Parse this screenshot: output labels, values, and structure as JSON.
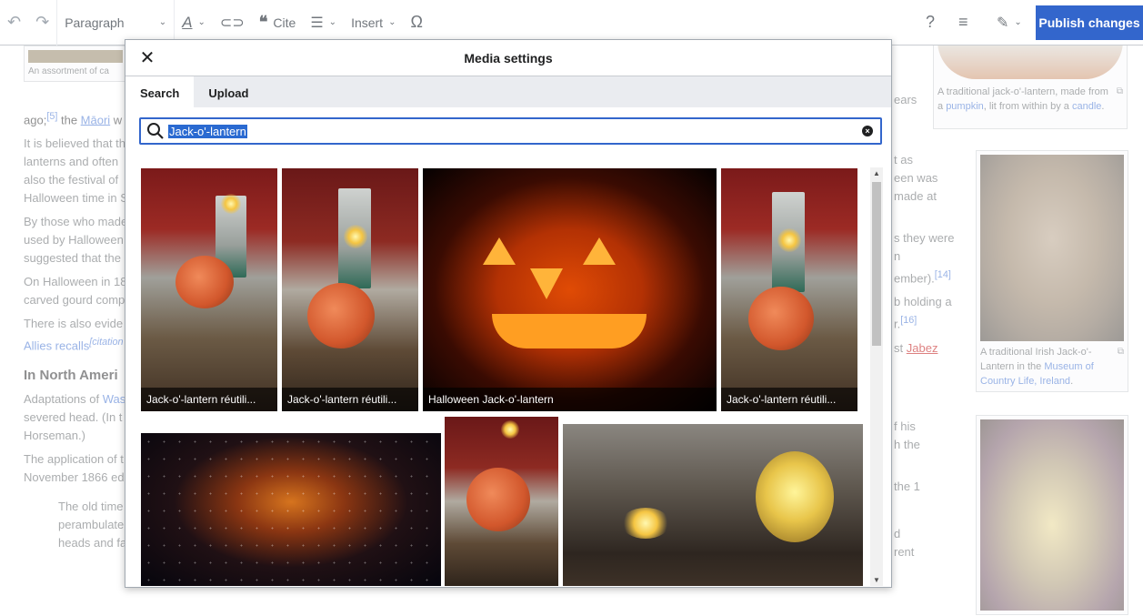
{
  "toolbar": {
    "format_label": "Paragraph",
    "cite_label": "Cite",
    "insert_label": "Insert",
    "help_glyph": "?",
    "publish_label": "Publish changes"
  },
  "article": {
    "top_thumb_caption": "An assortment of ca",
    "p1_start": "ago;",
    "p1_ref": "[5]",
    "p1_mid": " the ",
    "p1_link": "Māori",
    "p1_end": " w",
    "p1_right": "ears",
    "p2_lines": [
      "It is believed that th",
      "lanterns and often",
      "also the festival of",
      "Halloween time in S"
    ],
    "p2_right": [
      "t as",
      "een was",
      "made at",
      ""
    ],
    "p3_lines": [
      "By those who made",
      "used by Halloween",
      "suggested that the"
    ],
    "p3_right": [
      "s they were",
      "n",
      "ember)."
    ],
    "p3_ref": "[14]",
    "p4_lines": [
      "On Halloween in 18",
      "carved gourd comp"
    ],
    "p4_right": [
      "b holding a",
      "r."
    ],
    "p4_ref": "[16]",
    "p5_lines": [
      "There is also evide",
      "Allies recalls"
    ],
    "p5_ref": "[citation",
    "p5_right": "st",
    "p5_right_link": "Jabez",
    "heading": "In North Ameri",
    "p6_lines": [
      "Adaptations of",
      "severed head. (In t",
      "Horseman.)"
    ],
    "p6_link": "Was",
    "p6_right": [
      "f his",
      "h the",
      ""
    ],
    "p7_lines": [
      "The application of t",
      "November 1866 ed"
    ],
    "p7_right": "the 1",
    "quote_lines": [
      "The old time",
      "perambulate",
      "heads and face, lighted up by the unfailing (two inches of tallow candle."
    ],
    "quote_right": [
      "d",
      "rent"
    ]
  },
  "right_thumbs": [
    {
      "caption_plain": "A traditional jack-o'-lantern, made from a ",
      "caption_link1": "pumpkin",
      "caption_mid": ", lit from within by a ",
      "caption_link2": "candle",
      "caption_end": "."
    },
    {
      "caption_plain": "A traditional Irish Jack-o'-Lantern in the ",
      "caption_link1": "Museum of Country Life, Ireland",
      "caption_end": "."
    }
  ],
  "dialog": {
    "title": "Media settings",
    "tabs": [
      {
        "label": "Search",
        "active": true
      },
      {
        "label": "Upload",
        "active": false
      }
    ],
    "search": {
      "value": "Jack-o'-lantern"
    },
    "results": [
      {
        "caption": "Jack-o'-lantern réutili..."
      },
      {
        "caption": "Jack-o'-lantern réutili..."
      },
      {
        "caption": "Halloween Jack-o'-lantern"
      },
      {
        "caption": "Jack-o'-lantern réutili..."
      }
    ]
  },
  "colors": {
    "accent": "#3366cc",
    "link": "#3366cc",
    "redlink": "#ba0000"
  }
}
